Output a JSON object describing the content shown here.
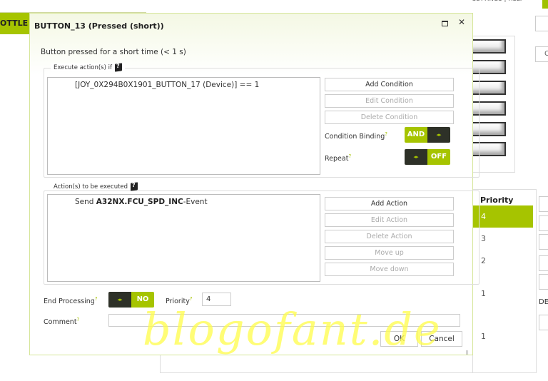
{
  "background": {
    "topnav": "SETTINGS | HELP",
    "tab_label": "OTTLE Q",
    "right_field_text": "C",
    "priority_panel": {
      "header": "Priority",
      "rows": [
        "4",
        "3",
        "2",
        "1",
        "1"
      ],
      "selected_index": 0
    },
    "side_label": "DE"
  },
  "dialog": {
    "title": "BUTTON_13 (Pressed (short))",
    "description": "Button pressed for a short time (< 1 s)",
    "conditions_group": {
      "legend": "Execute action(s) if",
      "items": [
        "[JOY_0X294B0X1901_BUTTON_17 (Device)] == 1"
      ],
      "buttons": [
        {
          "label": "Add Condition",
          "enabled": true
        },
        {
          "label": "Edit Condition",
          "enabled": false
        },
        {
          "label": "Delete Condition",
          "enabled": false
        }
      ],
      "condition_binding": {
        "label": "Condition Binding",
        "value": "AND"
      },
      "repeat": {
        "label": "Repeat",
        "value": "OFF"
      }
    },
    "actions_group": {
      "legend": "Action(s) to be executed",
      "items": [
        {
          "prefix": "Send ",
          "name": "A32NX.FCU_SPD_INC",
          "suffix": "-Event"
        }
      ],
      "buttons": [
        {
          "label": "Add Action",
          "enabled": true
        },
        {
          "label": "Edit Action",
          "enabled": false
        },
        {
          "label": "Delete Action",
          "enabled": false
        },
        {
          "label": "Move up",
          "enabled": false
        },
        {
          "label": "Move down",
          "enabled": false
        }
      ]
    },
    "end_processing": {
      "label": "End Processing",
      "value": "NO"
    },
    "priority": {
      "label": "Priority",
      "value": "4"
    },
    "comment": {
      "label": "Comment",
      "value": ""
    },
    "ok_label": "OK",
    "cancel_label": "Cancel",
    "toggle_arrows": "◂▸"
  },
  "watermark": "blogofant.de",
  "colors": {
    "accent": "#a6c400",
    "toggle_dark": "#2e3128"
  }
}
